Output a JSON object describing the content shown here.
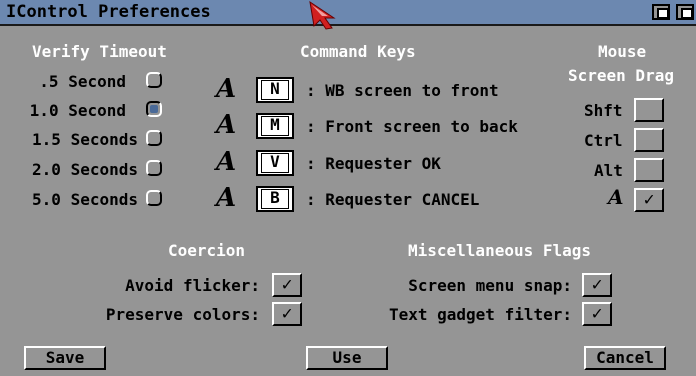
{
  "window": {
    "title": "IControl Preferences"
  },
  "verify": {
    "heading": "Verify Timeout",
    "options": [
      ".5 Second",
      "1.0 Second",
      "1.5 Seconds",
      "2.0 Seconds",
      "5.0 Seconds"
    ],
    "selected": "1.0 Second"
  },
  "command_keys": {
    "heading": "Command Keys",
    "rows": [
      {
        "key": "N",
        "label": ": WB screen to front"
      },
      {
        "key": "M",
        "label": ": Front screen to back"
      },
      {
        "key": "V",
        "label": ": Requester OK"
      },
      {
        "key": "B",
        "label": ": Requester CANCEL"
      }
    ]
  },
  "mouse": {
    "heading1": "Mouse",
    "heading2": "Screen Drag",
    "shft": {
      "label": "Shft",
      "checked": ""
    },
    "ctrl": {
      "label": "Ctrl",
      "checked": ""
    },
    "alt": {
      "label": "Alt",
      "checked": ""
    },
    "amiga": {
      "checked": "✓"
    }
  },
  "coercion": {
    "heading": "Coercion",
    "avoid_flicker": {
      "label": "Avoid flicker:",
      "checked": "✓"
    },
    "preserve_colors": {
      "label": "Preserve colors:",
      "checked": "✓"
    }
  },
  "misc": {
    "heading": "Miscellaneous Flags",
    "screen_menu_snap": {
      "label": "Screen menu snap:",
      "checked": "✓"
    },
    "text_gadget_filter": {
      "label": "Text gadget filter:",
      "checked": "✓"
    }
  },
  "buttons": {
    "save": "Save",
    "use": "Use",
    "cancel": "Cancel"
  },
  "icons": {
    "amiga": "A",
    "window_depth": "depth-gadget-icon",
    "pointer": "mouse-pointer-icon"
  },
  "colors": {
    "background": "#959595",
    "titlebar": "#6c88b0",
    "selected": "#4a6a98"
  }
}
